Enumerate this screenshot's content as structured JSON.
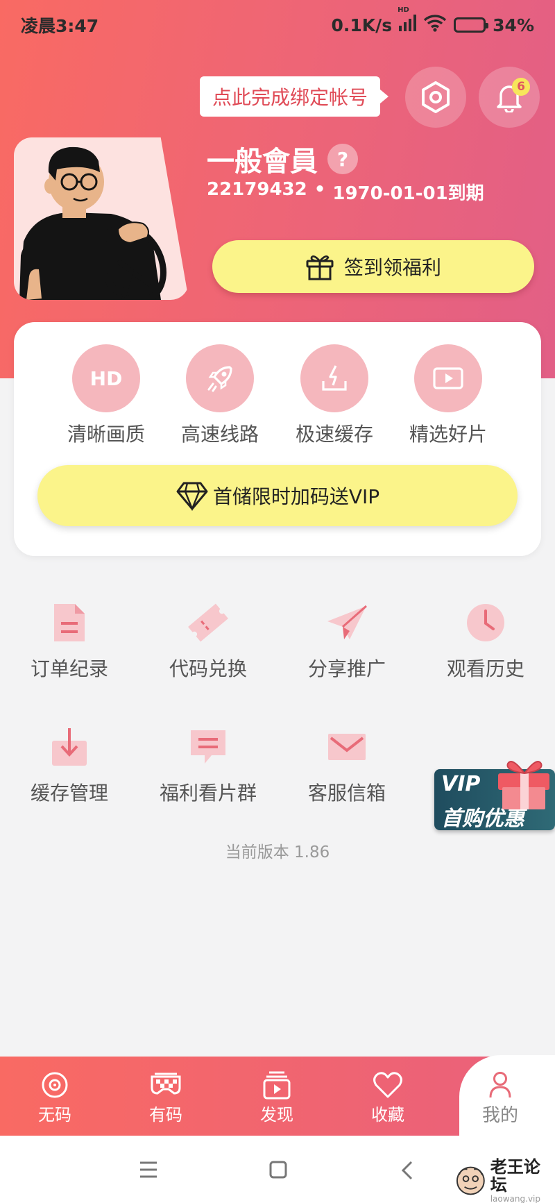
{
  "status_bar": {
    "time": "凌晨3:47",
    "net_speed": "0.1K/s",
    "signal_tag": "HD",
    "battery": "34%",
    "battery_level": 0.34
  },
  "header": {
    "bind_prompt": "点此完成绑定帐号",
    "notification_count": "6",
    "member_level": "一般會員",
    "help_mark": "?",
    "user_id": "22179432",
    "separator": "•",
    "expiry": "1970-01-01到期",
    "checkin_label": "签到领福利"
  },
  "features": [
    {
      "label": "清晰画质",
      "icon": "hd-icon",
      "icon_text": "HD"
    },
    {
      "label": "高速线路",
      "icon": "rocket-icon"
    },
    {
      "label": "极速缓存",
      "icon": "download-tray-icon"
    },
    {
      "label": "精选好片",
      "icon": "play-screen-icon"
    }
  ],
  "vip_button_label": "首储限时加码送VIP",
  "menu": [
    {
      "label": "订单纪录",
      "icon": "document-icon"
    },
    {
      "label": "代码兑换",
      "icon": "ticket-icon"
    },
    {
      "label": "分享推广",
      "icon": "paper-plane-icon"
    },
    {
      "label": "观看历史",
      "icon": "clock-icon"
    },
    {
      "label": "缓存管理",
      "icon": "download-icon"
    },
    {
      "label": "福利看片群",
      "icon": "chat-icon"
    },
    {
      "label": "客服信箱",
      "icon": "mail-icon"
    }
  ],
  "version_text": "当前版本 1.86",
  "promo": {
    "line1": "VIP",
    "line2": "首购优惠"
  },
  "bottom_nav": [
    {
      "label": "无码",
      "icon": "disc-icon"
    },
    {
      "label": "有码",
      "icon": "mosaic-mask-icon"
    },
    {
      "label": "发现",
      "icon": "video-stack-icon"
    },
    {
      "label": "收藏",
      "icon": "heart-icon"
    },
    {
      "label": "我的",
      "icon": "person-icon",
      "active": true
    }
  ],
  "watermark": {
    "title": "老王论坛",
    "sub": "laowang.vip"
  },
  "colors": {
    "header_start": "#f96a63",
    "header_end": "#e25f86",
    "accent_yellow": "#fbf48a",
    "feature_pink": "#f5b7bd",
    "menu_pink": "#e86b78"
  }
}
